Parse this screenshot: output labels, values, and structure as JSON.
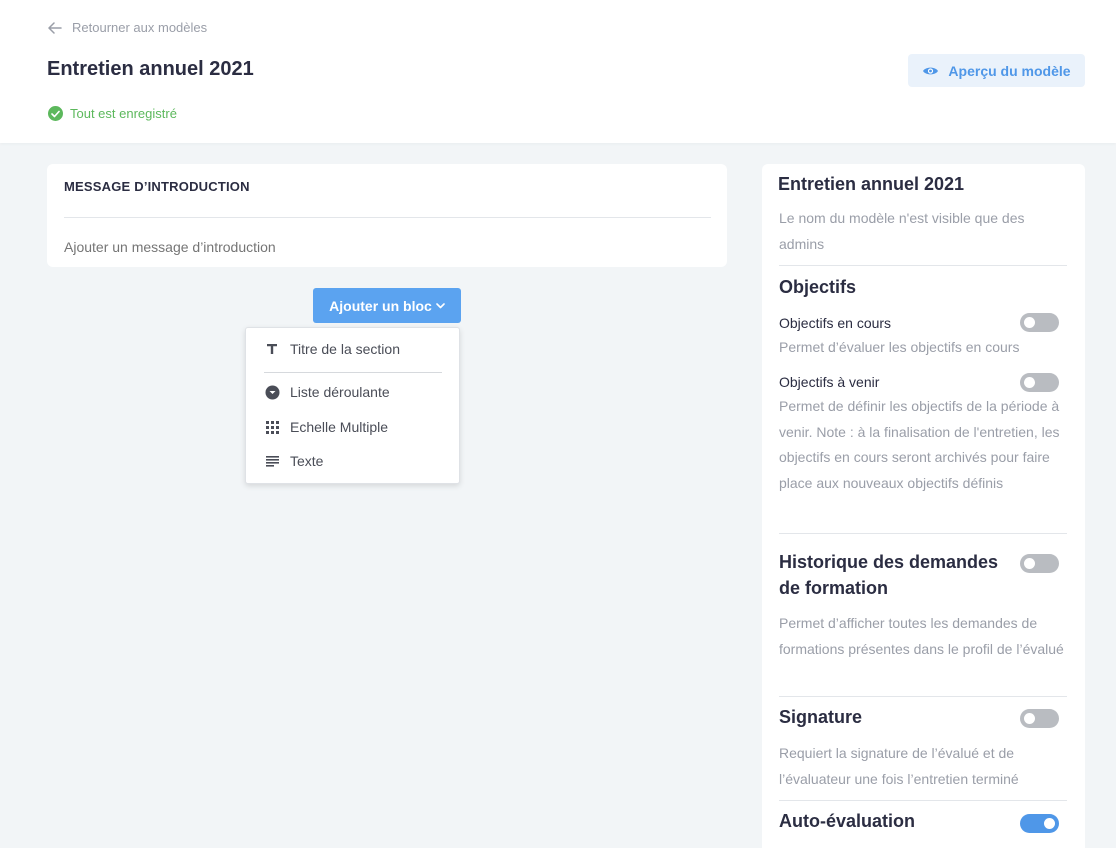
{
  "header": {
    "back_label": "Retourner aux modèles",
    "title": "Entretien annuel 2021",
    "save_status": "Tout est enregistré",
    "preview_label": "Aperçu du modèle"
  },
  "intro": {
    "title": "MESSAGE D’INTRODUCTION",
    "placeholder": "Ajouter un message d’introduction"
  },
  "add_block": {
    "label": "Ajouter un bloc",
    "menu": [
      {
        "label": "Titre de la section",
        "icon": "text-title-icon"
      },
      {
        "label": "Liste déroulante",
        "icon": "dropdown-circle-icon"
      },
      {
        "label": "Echelle Multiple",
        "icon": "grid-scale-icon"
      },
      {
        "label": "Texte",
        "icon": "text-lines-icon"
      }
    ]
  },
  "sidebar": {
    "title": "Entretien annuel 2021",
    "description": "Le nom du modèle n'est visible que des admins",
    "objectifs": {
      "title": "Objectifs",
      "items": [
        {
          "label": "Objectifs en cours",
          "description": "Permet d’évaluer les objectifs en cours",
          "enabled": false
        },
        {
          "label": "Objectifs à venir",
          "description": "Permet de définir les objectifs de la période à venir. Note : à la finalisation de l'entretien, les objectifs en cours seront archivés pour faire place aux nouveaux objectifs définis",
          "enabled": false
        }
      ]
    },
    "historique": {
      "title": "Historique des demandes de formation",
      "description": "Permet d’afficher toutes les demandes de formations présentes dans le profil de l’évalué",
      "enabled": false
    },
    "signature": {
      "title": "Signature",
      "description": "Requiert la signature de l’évalué et de l’évaluateur une fois l’entretien terminé",
      "enabled": false
    },
    "auto_evaluation": {
      "title": "Auto-évaluation",
      "enabled": true
    }
  },
  "colors": {
    "accent": "#4f97e8",
    "button": "#5ba3f0",
    "success": "#5cb85c",
    "background": "#f2f5f7"
  }
}
